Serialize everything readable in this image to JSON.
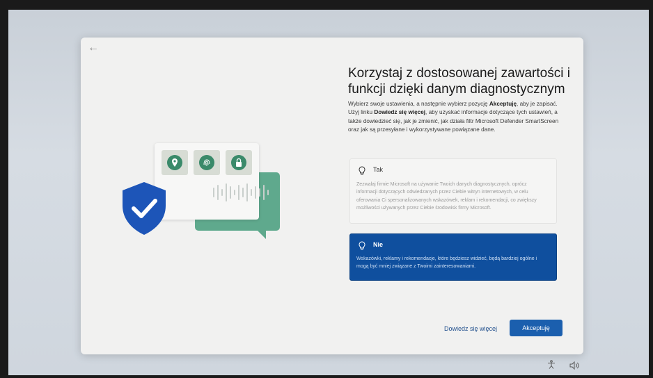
{
  "header": {
    "back_label": "←"
  },
  "content": {
    "title": "Korzystaj z dostosowanej zawartości i funkcji dzięki danym diagnostycznym",
    "description_parts": {
      "p1": "Wybierz swoje ustawienia, a następnie wybierz pozycję ",
      "b1": "Akceptuję",
      "p2": ", aby je zapisać. Użyj linku ",
      "b2": "Dowiedz się więcej",
      "p3": ", aby uzyskać informacje dotyczące tych ustawień, a także dowiedzieć się, jak je zmienić, jak działa filtr Microsoft Defender SmartScreen oraz jak są przesyłane i wykorzystywane powiązane dane."
    }
  },
  "options": [
    {
      "label": "Tak",
      "text": "Zezwalaj firmie Microsoft na używanie Twoich danych diagnostycznych, oprócz informacji dotyczących odwiedzanych przez Ciebie witryn internetowych, w celu oferowania Ci spersonalizowanych wskazówek, reklam i rekomendacji, co zwiększy możliwości używanych przez Ciebie środowisk firmy Microsoft.",
      "selected": false,
      "icon": "lightbulb-icon"
    },
    {
      "label": "Nie",
      "text": "Wskazówki, reklamy i rekomendacje, które będziesz widzieć, będą bardziej ogólne i mogą być mniej związane z Twoimi zainteresowaniami.",
      "selected": true,
      "icon": "lightbulb-icon"
    }
  ],
  "footer": {
    "learn_more_label": "Dowiedz się więcej",
    "accept_label": "Akceptuję"
  },
  "tray": {
    "accessibility_icon": "accessibility-icon",
    "volume_icon": "volume-icon"
  },
  "colors": {
    "accent": "#1b5fae",
    "selected_option": "#0f4f9e",
    "shield": "#1d55b8",
    "illustration_green": "#3a8a6a"
  },
  "illustration": {
    "tile_icons": [
      "location-pin-icon",
      "fingerprint-icon",
      "lock-icon"
    ],
    "shield_icon": "shield-check-icon"
  }
}
